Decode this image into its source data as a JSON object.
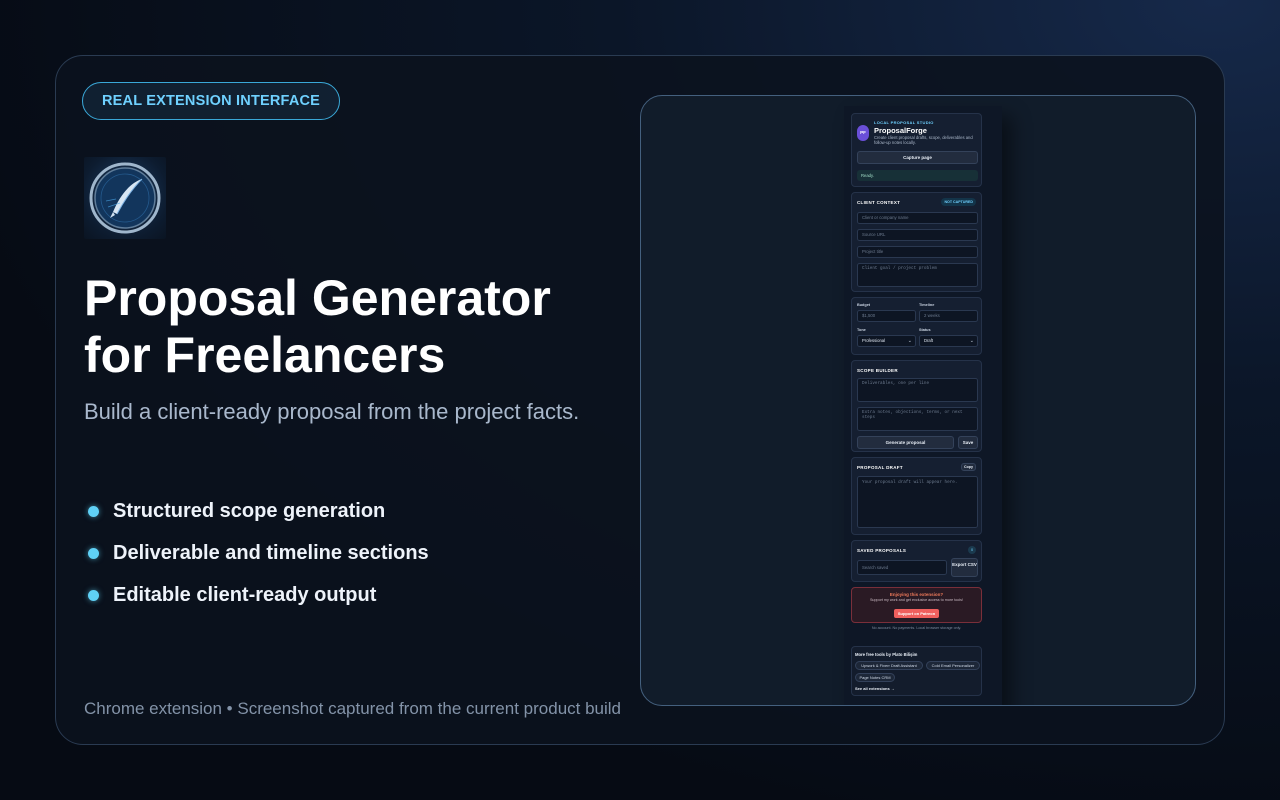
{
  "badge": "REAL EXTENSION INTERFACE",
  "title": "Proposal Generator for Freelancers",
  "subtitle": "Build a client-ready proposal from the project facts.",
  "features": [
    "Structured scope generation",
    "Deliverable and timeline sections",
    "Editable client-ready output"
  ],
  "footer": "Chrome extension • Screenshot captured from the current product build",
  "colors": {
    "accent": "#5fd0f5",
    "background": "#0b121e",
    "support_button": "#f0605e"
  },
  "extension": {
    "header": {
      "eyebrow": "LOCAL PROPOSAL STUDIO",
      "avatar": "PF",
      "name": "ProposalForge",
      "description": "Create client proposal drafts, scope, deliverables and follow-up notes locally.",
      "capture_button": "Capture page",
      "status": "Ready."
    },
    "client_context": {
      "heading": "CLIENT CONTEXT",
      "badge": "NOT CAPTURED",
      "client_placeholder": "Client or company name",
      "url_placeholder": "Source URL",
      "project_placeholder": "Project title",
      "goal_placeholder": "Client goal / project problem"
    },
    "details": {
      "budget_label": "Budget",
      "budget_placeholder": "$1,500",
      "timeline_label": "Timeline",
      "timeline_placeholder": "2 weeks",
      "tone_label": "Tone",
      "tone_value": "Professional",
      "status_label": "Status",
      "status_value": "Draft"
    },
    "scope_builder": {
      "heading": "SCOPE BUILDER",
      "deliverables_placeholder": "Deliverables, one per line",
      "notes_placeholder": "Extra notes, objections, terms, or next steps",
      "generate_button": "Generate proposal",
      "save_button": "Save"
    },
    "draft": {
      "heading": "PROPOSAL DRAFT",
      "copy_button": "Copy",
      "placeholder": "Your proposal draft will appear here."
    },
    "saved": {
      "heading": "SAVED PROPOSALS",
      "count": "0",
      "search_placeholder": "Search saved",
      "export_button": "Export CSV"
    },
    "support": {
      "title": "Enjoying this extension?",
      "text": "Support my work and get exclusive access to more tools!",
      "button": "Support on Patreon",
      "note": "No account. No payments. Local browser storage only."
    },
    "more_tools": {
      "heading": "More free tools by Plato Bilişim",
      "tools": [
        "Upwork & Fiverr Draft Assistant",
        "Cold Email Personalizer",
        "Page Notes CRM"
      ],
      "see_all": "See all extensions →"
    }
  }
}
